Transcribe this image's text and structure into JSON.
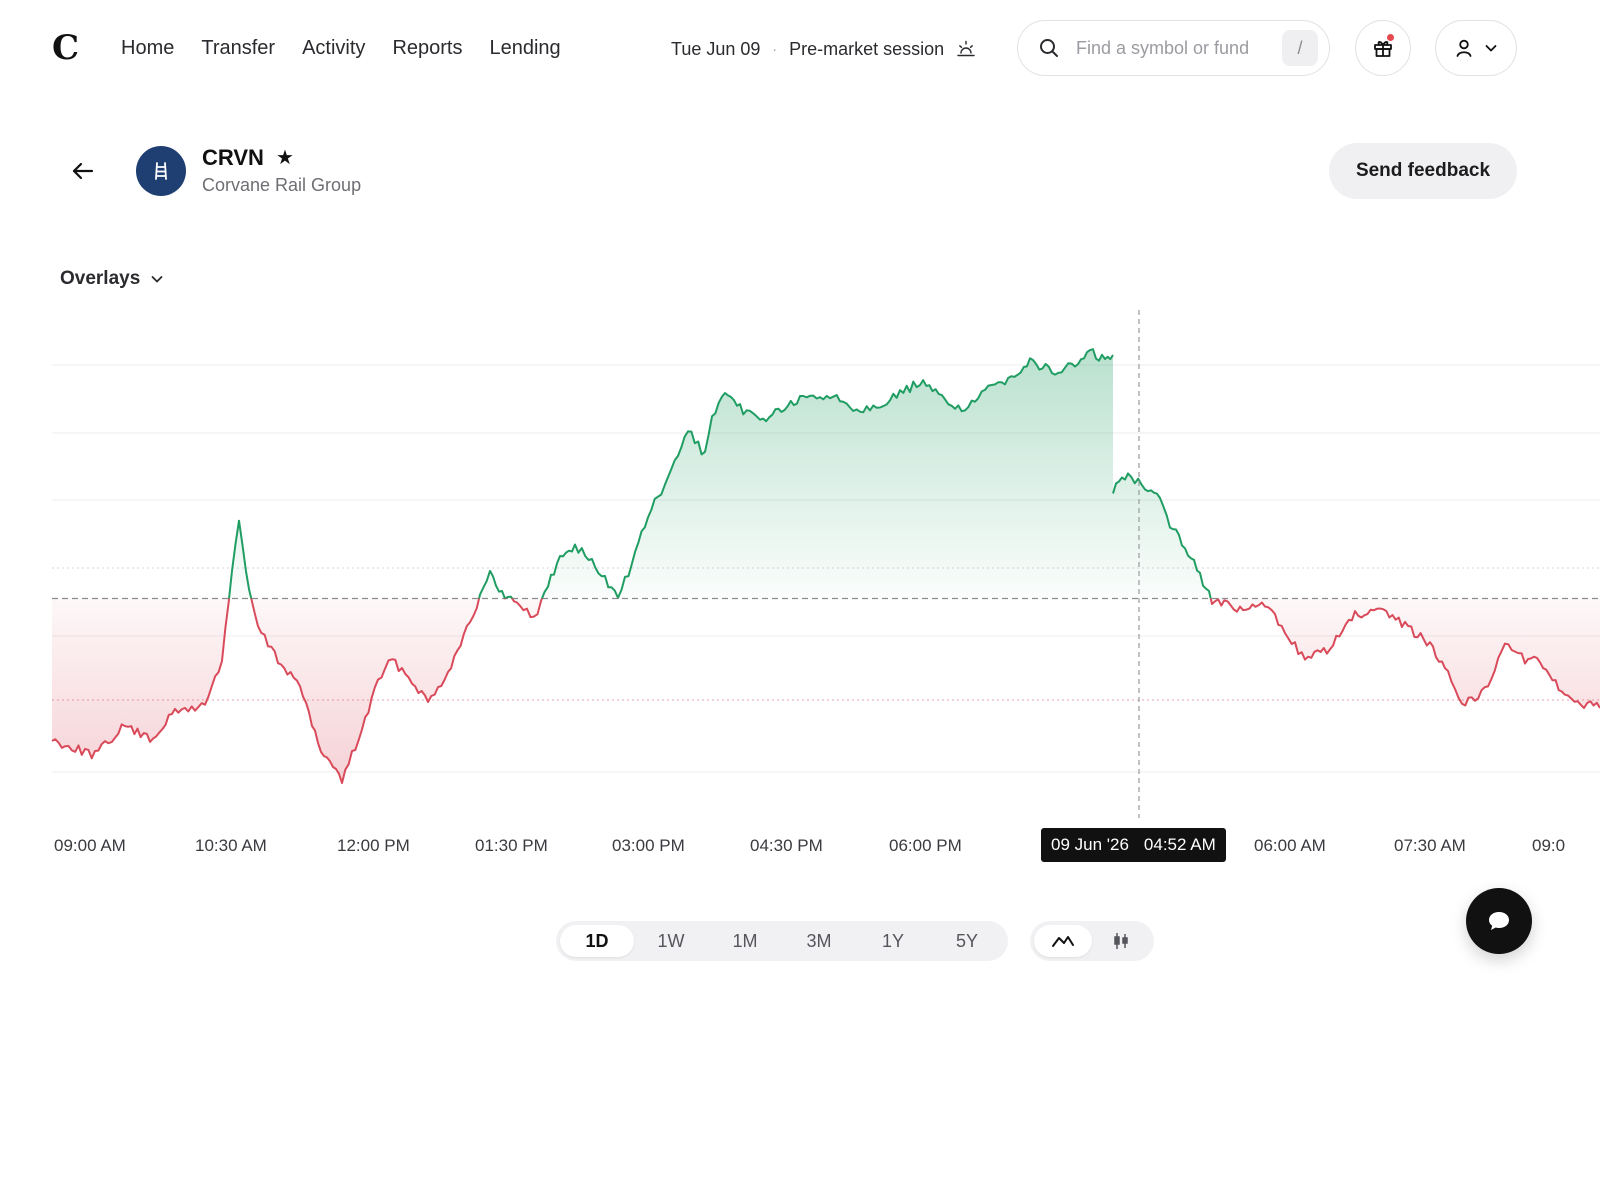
{
  "header": {
    "logo": "C",
    "nav": [
      "Home",
      "Transfer",
      "Activity",
      "Reports",
      "Lending"
    ],
    "session_date": "Tue Jun 09",
    "session_separator": "·",
    "session_label": "Pre-market session",
    "search_placeholder": "Find a symbol or fund",
    "search_shortcut": "/"
  },
  "stock": {
    "ticker": "CRVN",
    "company": "Corvane Rail Group",
    "favorite_icon": "★"
  },
  "actions": {
    "feedback_label": "Send feedback",
    "overlays_label": "Overlays"
  },
  "chart": {
    "x_ticks": [
      "09:00 AM",
      "10:30 AM",
      "12:00 PM",
      "01:30 PM",
      "03:00 PM",
      "04:30 PM",
      "06:00 PM",
      "06:00 AM",
      "07:30 AM",
      "09:0"
    ],
    "cursor_date": "09 Jun '26",
    "cursor_time": "04:52 AM"
  },
  "ranges": [
    "1D",
    "1W",
    "1M",
    "3M",
    "1Y",
    "5Y"
  ],
  "active_range": "1D",
  "colors": {
    "up": "#1f9d62",
    "down": "#d94a5a",
    "accent": "#1f3f73"
  }
}
